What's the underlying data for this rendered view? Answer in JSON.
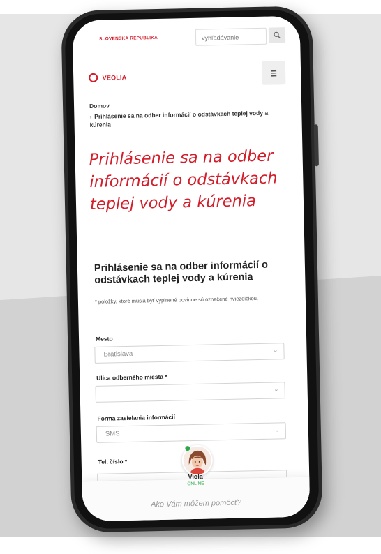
{
  "header": {
    "country": "SLOVENSKÁ REPUBLIKA",
    "search_placeholder": "vyhľadávanie",
    "search_icon": "search-icon"
  },
  "brand": {
    "logo_text": "VEOLIA",
    "accent_color": "#d21e2b",
    "menu_icon": "hamburger-menu-icon"
  },
  "breadcrumb": {
    "home": "Domov",
    "current": "Prihlásenie sa na odber informácií o odstávkach teplej vody a kúrenia"
  },
  "page": {
    "hero_title": "Prihlásenie sa na odber informácií o odstávkach teplej vody a kúrenia",
    "form_title": "Prihlásenie sa na odber informácií o odstávkach teplej vody a kúrenia",
    "required_note": "* položky, ktoré musia byť vyplnené povinne sú označené hviezdičkou."
  },
  "form": {
    "city": {
      "label": "Mesto",
      "value": "Bratislava"
    },
    "street": {
      "label": "Ulica odberného miesta *",
      "value": ""
    },
    "delivery": {
      "label": "Forma zasielania informácií",
      "value": "SMS"
    },
    "phone": {
      "label": "Tel. číslo *",
      "value": ""
    }
  },
  "chat": {
    "agent_name": "Viola",
    "status": "ONLINE",
    "prompt": "Ako Vám môžem pomôcť?",
    "status_color": "#2ca84a"
  }
}
